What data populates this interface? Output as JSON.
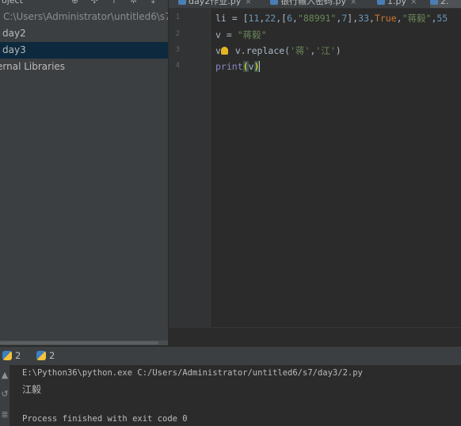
{
  "project_panel": {
    "header_label": "oject",
    "tool_glyphs": "⊕ ✣ ↑ ✲ ↕",
    "items": [
      {
        "label": "C:\\Users\\Administrator\\untitled6\\s7"
      },
      {
        "label": "day2"
      },
      {
        "label": "day3"
      },
      {
        "label": "ernal Libraries"
      }
    ]
  },
  "tabs": [
    {
      "label": "day2作业.py",
      "close": "×"
    },
    {
      "label": "银行输入密码.py",
      "close": "×"
    },
    {
      "label": "1.py",
      "close": "×"
    },
    {
      "label": "2."
    }
  ],
  "editor": {
    "line_numbers": [
      "1",
      "2",
      "3",
      "4"
    ],
    "lines": {
      "l1": {
        "a": "li = [",
        "n11": "11",
        "c1": ",",
        "n22": "22",
        "c2": ",[",
        "n6": "6",
        "c3": ",",
        "s1": "\"88991\"",
        "c4": ",",
        "n7": "7",
        "c5": "],",
        "n33": "33",
        "c6": ",",
        "kwTrue": "True",
        "c7": ",",
        "s2": "\"蒋毅\"",
        "c8": ",",
        "n55": "55"
      },
      "l2": {
        "a": "v = ",
        "s": "\"蒋毅\""
      },
      "l3": {
        "a": "v",
        "b": " v.replace(",
        "s1": "'蒋'",
        "c": ",",
        "s2": "'江'",
        "d": ")"
      },
      "l4": {
        "fn": "print",
        "p1": "(",
        "arg": "v",
        "p2": ")"
      }
    }
  },
  "run_panel": {
    "tabs": [
      {
        "label": "2"
      },
      {
        "label": "2"
      }
    ],
    "toolbar_glyphs": [
      "▲",
      "↺",
      "≣"
    ],
    "console": {
      "command": "E:\\Python36\\python.exe C:/Users/Administrator/untitled6/s7/day3/2.py",
      "output": "江毅",
      "exit": "Process finished with exit code 0"
    }
  },
  "colors": {
    "panel_bg": "#3c3f41",
    "editor_bg": "#2b2b2b",
    "selection": "#0d293e",
    "number": "#6897bb",
    "string": "#6a8759",
    "keyword": "#cc7832",
    "builtin": "#8888c6"
  }
}
